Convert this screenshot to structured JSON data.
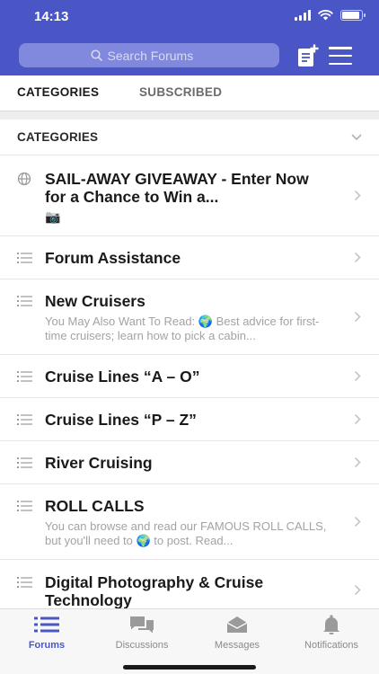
{
  "status_bar": {
    "time": "14:13"
  },
  "header": {
    "search_placeholder": "Search Forums",
    "accent": "#4a56c6"
  },
  "tabs": [
    {
      "label": "CATEGORIES",
      "active": true
    },
    {
      "label": "SUBSCRIBED",
      "active": false
    }
  ],
  "section": {
    "title": "CATEGORIES"
  },
  "forums": [
    {
      "icon": "globe-icon",
      "title": "SAIL-AWAY GIVEAWAY - Enter Now for a Chance to Win a...",
      "subtitle": "📷"
    },
    {
      "icon": "list-icon",
      "title": "Forum Assistance",
      "subtitle": ""
    },
    {
      "icon": "list-icon",
      "title": "New Cruisers",
      "subtitle": "You May Also Want To Read:  🌍 Best advice for first-time cruisers; learn how to pick a cabin..."
    },
    {
      "icon": "list-icon",
      "title": "Cruise Lines “A – O”",
      "subtitle": ""
    },
    {
      "icon": "list-icon",
      "title": "Cruise Lines “P – Z”",
      "subtitle": ""
    },
    {
      "icon": "list-icon",
      "title": "River Cruising",
      "subtitle": ""
    },
    {
      "icon": "list-icon",
      "title": "ROLL CALLS",
      "subtitle": "You can browse and read our FAMOUS ROLL CALLS, but you'll need to 🌍 to post. Read..."
    },
    {
      "icon": "list-icon",
      "title": "Digital Photography & Cruise Technology",
      "subtitle": ""
    }
  ],
  "bottom_nav": [
    {
      "label": "Forums",
      "icon": "forums-list-icon",
      "active": true
    },
    {
      "label": "Discussions",
      "icon": "chat-bubbles-icon",
      "active": false
    },
    {
      "label": "Messages",
      "icon": "envelope-icon",
      "active": false
    },
    {
      "label": "Notifications",
      "icon": "bell-icon",
      "active": false
    }
  ]
}
